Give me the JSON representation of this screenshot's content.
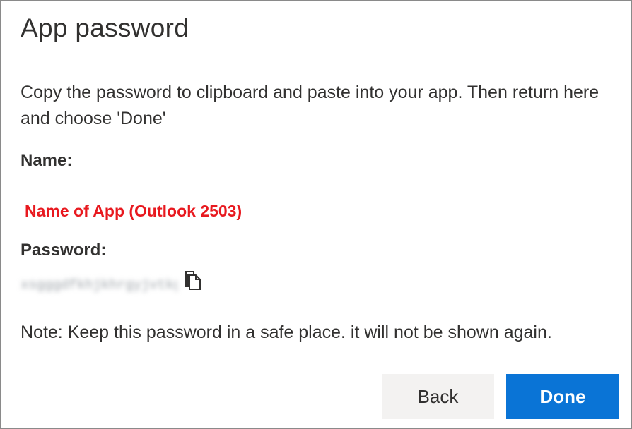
{
  "dialog": {
    "title": "App password",
    "instructions": "Copy the password to clipboard and paste into your app. Then return here and choose 'Done'",
    "name_label": "Name:",
    "app_name": "Name of App (Outlook 2503)",
    "password_label": "Password:",
    "password_value": "xsgggdfkhjkhrgyjvtkg",
    "copy_icon": "copy-icon",
    "note": "Note: Keep this password in a safe place. it will not be shown again.",
    "back_label": "Back",
    "done_label": "Done"
  },
  "colors": {
    "app_name": "#e8191f",
    "done_button": "#0a74d6",
    "back_button": "#f3f2f1",
    "text": "#323130",
    "border": "#8a8a8a"
  }
}
